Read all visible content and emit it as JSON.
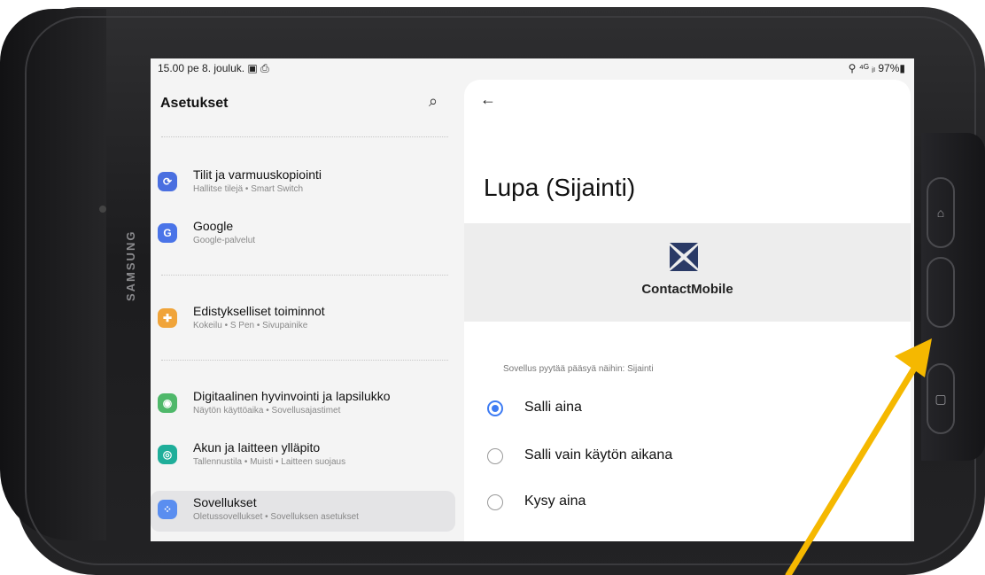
{
  "device": {
    "brand": "SAMSUNG"
  },
  "status_bar": {
    "left": "15.00  pe 8. jouluk.  ▣ ⎙",
    "right": "⚲ ⁴ᴳ ᵢₗ 97%▮"
  },
  "settings": {
    "title": "Asetukset",
    "items": [
      {
        "title": "Tilit ja varmuuskopiointi",
        "subtitle": "Hallitse tilejä  •  Smart Switch",
        "icon": "sync-icon",
        "glyph": "⟳",
        "color": "#4a6fe0"
      },
      {
        "title": "Google",
        "subtitle": "Google-palvelut",
        "icon": "google-icon",
        "glyph": "G",
        "color": "#4a74e8"
      },
      {
        "title": "Edistykselliset toiminnot",
        "subtitle": "Kokeilu  •  S Pen  •  Sivupainike",
        "icon": "gear-plus-icon",
        "glyph": "✚",
        "color": "#f0a43a"
      },
      {
        "title": "Digitaalinen hyvinvointi ja lapsilukko",
        "subtitle": "Näytön käyttöaika  •  Sovellusajastimet",
        "icon": "wellbeing-icon",
        "glyph": "◉",
        "color": "#4fb86a"
      },
      {
        "title": "Akun ja laitteen ylläpito",
        "subtitle": "Tallennustila  •  Muisti  •  Laitteen suojaus",
        "icon": "device-care-icon",
        "glyph": "◎",
        "color": "#1fae9a"
      },
      {
        "title": "Sovellukset",
        "subtitle": "Oletussovellukset  •  Sovelluksen asetukset",
        "icon": "apps-icon",
        "glyph": "⁘",
        "color": "#5a8ef0"
      }
    ]
  },
  "permission": {
    "title": "Lupa (Sijainti)",
    "app_name": "ContactMobile",
    "request_text": "Sovellus pyytää pääsyä näihin: Sijainti",
    "options": [
      {
        "label": "Salli aina",
        "selected": true
      },
      {
        "label": "Salli vain käytön aikana",
        "selected": false
      },
      {
        "label": "Kysy aina",
        "selected": false
      }
    ]
  },
  "colors": {
    "accent": "#3e7cf3",
    "annotation_arrow": "#f5b800"
  }
}
